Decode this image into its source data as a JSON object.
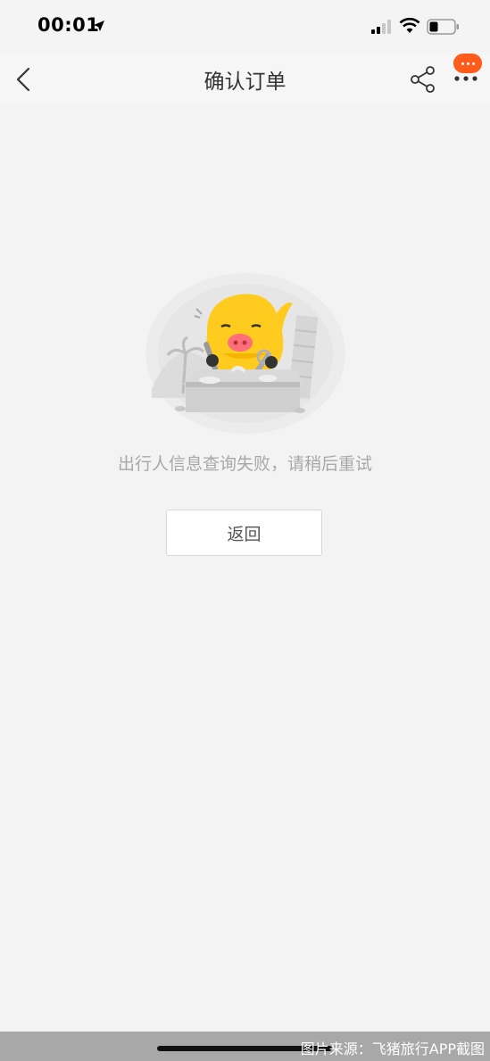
{
  "status_bar": {
    "time": "00:01",
    "icons": [
      "location-arrow-icon",
      "signal-icon",
      "wifi-icon",
      "battery-icon"
    ]
  },
  "nav": {
    "title": "确认订单",
    "back_icon": "chevron-left-icon",
    "share_icon": "share-icon",
    "more_icon": "more-dots-icon",
    "badge_color": "#ff5b1a"
  },
  "content": {
    "illustration": "fliggy-pig-mascot-illustration",
    "error_message": "出行人信息查询失败，请稍后重试",
    "return_button_label": "返回"
  },
  "footer": {
    "watermark": "图片来源：飞猪旅行APP截图"
  }
}
